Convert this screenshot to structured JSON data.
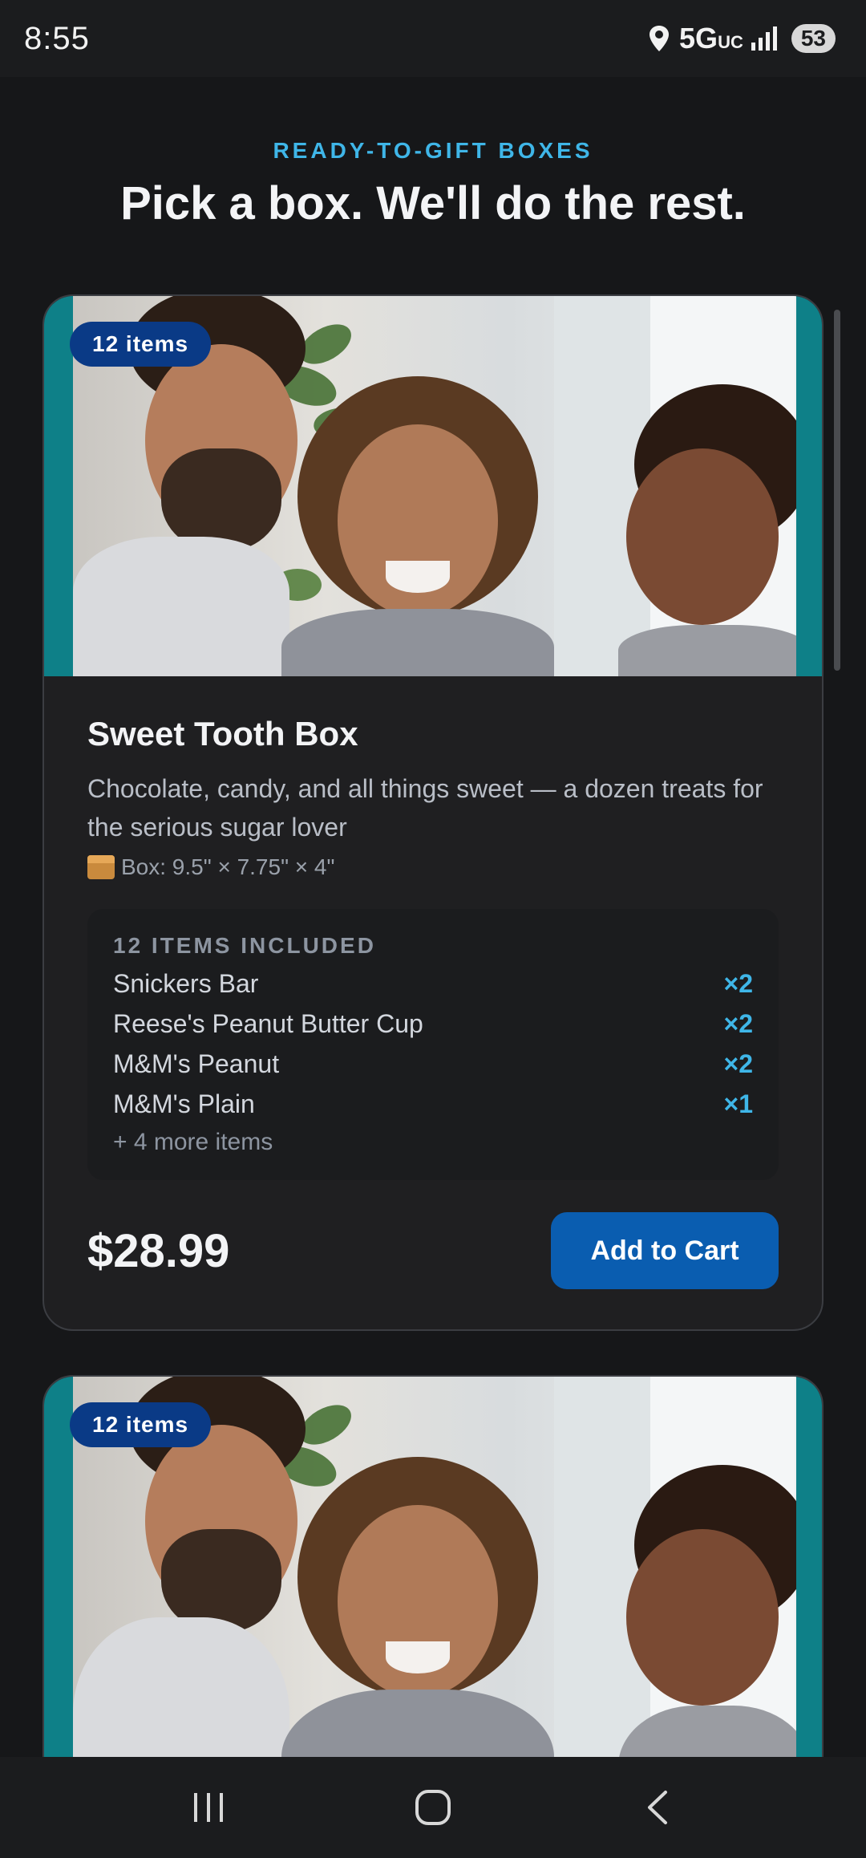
{
  "status_bar": {
    "time": "8:55",
    "network": "5G",
    "network_sub": "UC",
    "battery": "53"
  },
  "header": {
    "eyebrow": "READY-TO-GIFT BOXES",
    "headline": "Pick a box. We'll do the rest."
  },
  "cards": [
    {
      "badge": "12 items",
      "title": "Sweet Tooth Box",
      "description": "Chocolate, candy, and all things sweet — a dozen treats for the serious sugar lover",
      "box_size": "Box: 9.5\" × 7.75\" × 4\"",
      "included_title": "12 ITEMS INCLUDED",
      "items": [
        {
          "name": "Snickers Bar",
          "qty": "×2"
        },
        {
          "name": "Reese's Peanut Butter Cup",
          "qty": "×2"
        },
        {
          "name": "M&M's Peanut",
          "qty": "×2"
        },
        {
          "name": "M&M's Plain",
          "qty": "×1"
        }
      ],
      "more": "+ 4 more items",
      "price": "$28.99",
      "cta": "Add to Cart"
    },
    {
      "badge": "12 items"
    }
  ],
  "colors": {
    "accent": "#3fb6e8",
    "button": "#0a5db0",
    "badge": "#0a3a86",
    "teal": "#0e8088",
    "background": "#161719"
  },
  "icons": {
    "location": "location-pin-icon",
    "signal": "signal-icon",
    "box": "package-icon",
    "nav_recent": "recent-apps-icon",
    "nav_home": "home-icon",
    "nav_back": "back-icon"
  }
}
